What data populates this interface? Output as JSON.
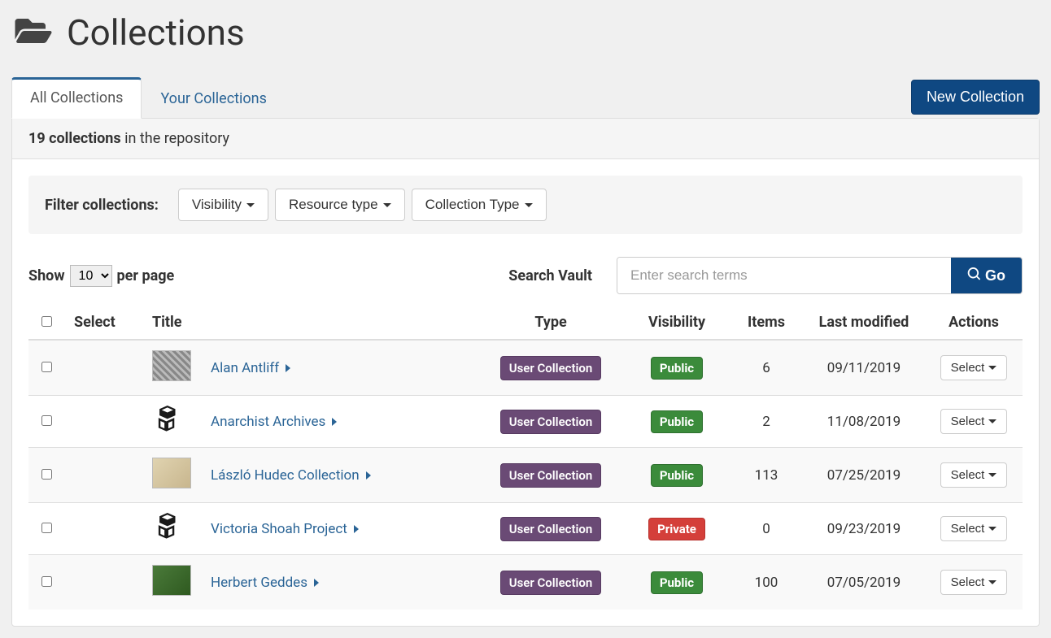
{
  "page_title": "Collections",
  "tabs": [
    {
      "label": "All Collections",
      "active": true
    },
    {
      "label": "Your Collections",
      "active": false
    }
  ],
  "new_collection_label": "New Collection",
  "heading": {
    "count_text": "19 collections",
    "rest_text": " in the repository"
  },
  "filters": {
    "label": "Filter collections:",
    "buttons": [
      "Visibility",
      "Resource type",
      "Collection Type"
    ]
  },
  "show": {
    "prefix": "Show",
    "value": "10",
    "options": [
      "10"
    ],
    "suffix": "per page"
  },
  "search": {
    "label": "Search Vault",
    "placeholder": "Enter search terms",
    "go_label": "Go"
  },
  "table": {
    "headers": {
      "select": "Select",
      "title": "Title",
      "type": "Type",
      "visibility": "Visibility",
      "items": "Items",
      "modified": "Last modified",
      "actions": "Actions"
    },
    "action_button_label": "Select",
    "rows": [
      {
        "thumb": "grey",
        "title": "Alan Antliff",
        "type": "User Collection",
        "visibility": "Public",
        "vis_class": "public",
        "items": "6",
        "modified": "09/11/2019"
      },
      {
        "thumb": "cube",
        "title": "Anarchist Archives",
        "type": "User Collection",
        "visibility": "Public",
        "vis_class": "public",
        "items": "2",
        "modified": "11/08/2019"
      },
      {
        "thumb": "sepia",
        "title": "László Hudec Collection",
        "type": "User Collection",
        "visibility": "Public",
        "vis_class": "public",
        "items": "113",
        "modified": "07/25/2019"
      },
      {
        "thumb": "cube",
        "title": "Victoria Shoah Project",
        "type": "User Collection",
        "visibility": "Private",
        "vis_class": "private",
        "items": "0",
        "modified": "09/23/2019"
      },
      {
        "thumb": "green",
        "title": "Herbert Geddes",
        "type": "User Collection",
        "visibility": "Public",
        "vis_class": "public",
        "items": "100",
        "modified": "07/05/2019"
      }
    ]
  }
}
